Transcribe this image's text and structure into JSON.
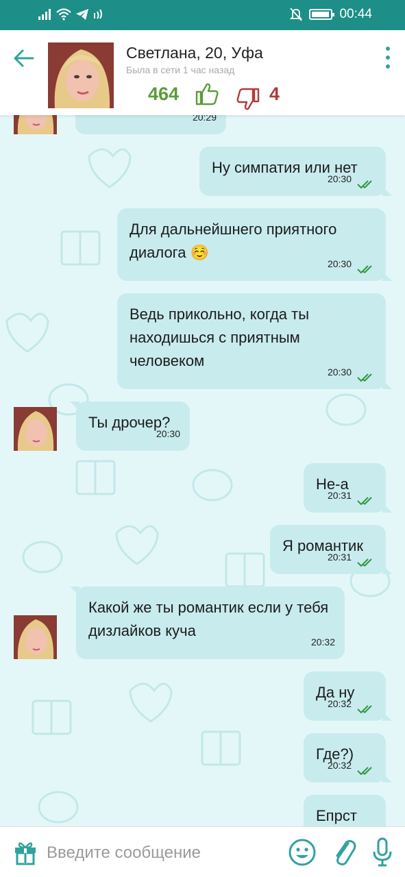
{
  "status_bar": {
    "time": "00:44",
    "icons": [
      "signal-icon",
      "wifi-icon",
      "telegram-icon",
      "nfc-icon",
      "mute-icon",
      "battery-icon"
    ]
  },
  "header": {
    "back_icon": "arrow-left-icon",
    "name": "Светлана, 20, Уфа",
    "last_seen": "Была в сети 1 час назад",
    "likes": "464",
    "dislikes": "4",
    "menu_icon": "more-vertical-icon"
  },
  "colors": {
    "status_bar": "#1d8e88",
    "accent": "#2fa39c",
    "bubble": "#c8ebee",
    "background": "#e4f7f8",
    "likes": "#5d9b3a",
    "dislikes": "#b23a3a",
    "ticks": "#2e9a3a"
  },
  "messages": [
    {
      "direction": "in",
      "text": "",
      "time": "20:29",
      "avatar": true
    },
    {
      "direction": "out",
      "text": "Ну симпатия или нет",
      "time": "20:30",
      "read": true
    },
    {
      "direction": "out",
      "text": "Для дальнейшнего приятного диалога ☺️",
      "time": "20:30",
      "read": true
    },
    {
      "direction": "out",
      "text": "Ведь прикольно, когда ты находишься с приятным человеком",
      "time": "20:30",
      "read": true
    },
    {
      "direction": "in",
      "text": "Ты дрочер?",
      "time": "20:30",
      "avatar": true
    },
    {
      "direction": "out",
      "text": "Не-а",
      "time": "20:31",
      "read": true
    },
    {
      "direction": "out",
      "text": "Я романтик",
      "time": "20:31",
      "read": true
    },
    {
      "direction": "in",
      "text": "Какой же ты романтик если у тебя дизлайков куча",
      "time": "20:32",
      "avatar": true
    },
    {
      "direction": "out",
      "text": "Да ну",
      "time": "20:32",
      "read": true
    },
    {
      "direction": "out",
      "text": "Где?)",
      "time": "20:32",
      "read": true
    },
    {
      "direction": "out",
      "text": "Епрст",
      "time": "",
      "read": false
    }
  ],
  "composer": {
    "placeholder": "Введите сообщение",
    "gift_icon": "gift-icon",
    "emoji_icon": "smiley-icon",
    "attach_icon": "paperclip-icon",
    "mic_icon": "microphone-icon"
  }
}
